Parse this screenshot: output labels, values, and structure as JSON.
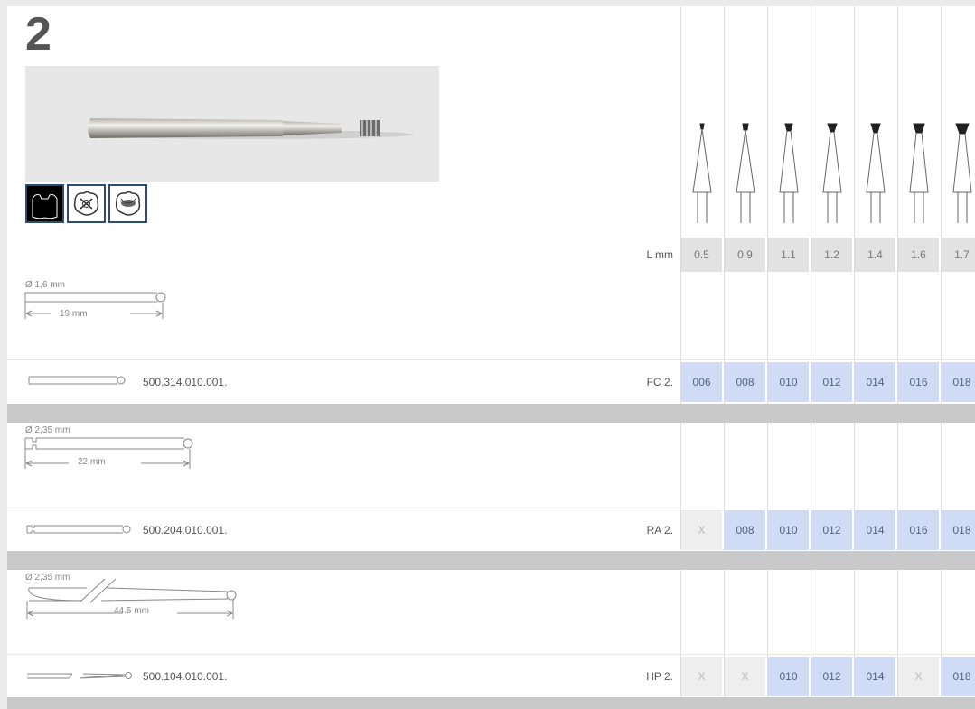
{
  "page_number": "2",
  "icons": [
    "crown-cavity-icon",
    "shield-cross-icon",
    "shield-atom-icon"
  ],
  "lmm_label": "L mm",
  "lengths": [
    "0.5",
    "0.9",
    "1.1",
    "1.2",
    "1.4",
    "1.6",
    "1.7"
  ],
  "groups": [
    {
      "diameter": "Ø 1,6 mm",
      "length": "19 mm",
      "ref": "500.314.010.001.",
      "type": "FC 2.",
      "codes": [
        "006",
        "008",
        "010",
        "012",
        "014",
        "016",
        "018"
      ]
    },
    {
      "diameter": "Ø 2,35 mm",
      "length": "22 mm",
      "ref": "500.204.010.001.",
      "type": "RA 2.",
      "codes": [
        "X",
        "008",
        "010",
        "012",
        "014",
        "016",
        "018"
      ]
    },
    {
      "diameter": "Ø 2,35 mm",
      "length": "44.5 mm",
      "ref": "500.104.010.001.",
      "type": "HP 2.",
      "codes": [
        "X",
        "X",
        "010",
        "012",
        "014",
        "X",
        "018"
      ]
    }
  ]
}
